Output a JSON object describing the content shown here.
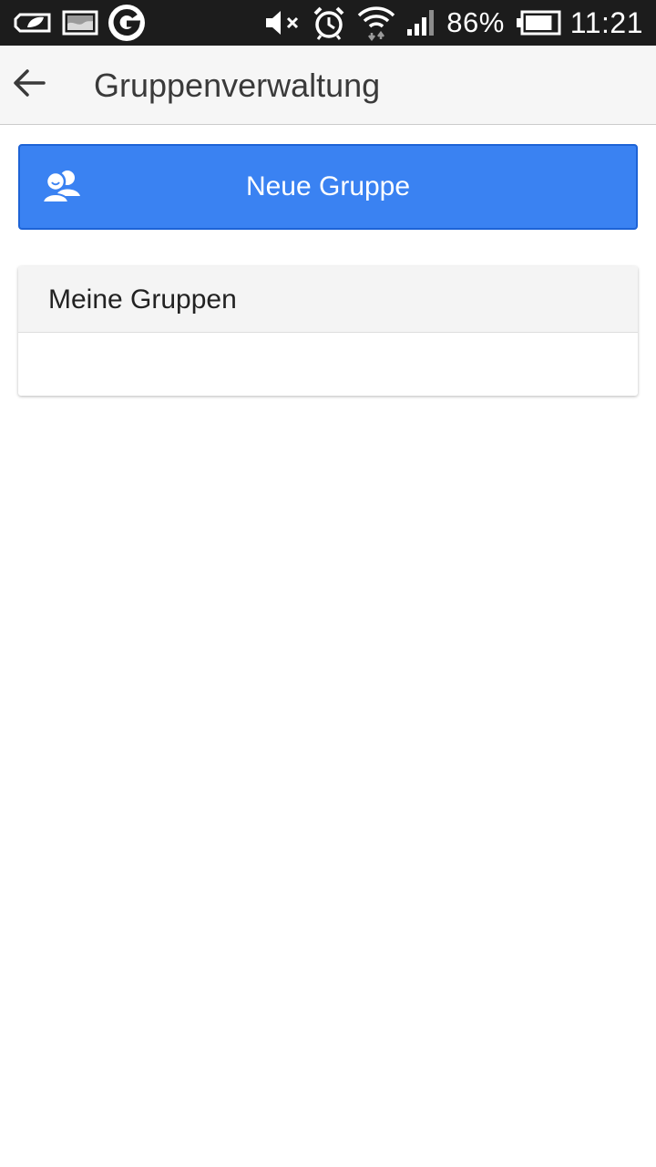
{
  "status_bar": {
    "icons_left": [
      "battery-saver-icon",
      "image-notification-icon",
      "g-app-icon"
    ],
    "icons_right": [
      "mute-icon",
      "alarm-icon",
      "wifi-icon",
      "signal-icon"
    ],
    "battery_percent": "86%",
    "battery_level": 0.86,
    "time": "11:21"
  },
  "app_bar": {
    "back_icon": "arrow-left-icon",
    "title": "Gruppenverwaltung"
  },
  "new_group_button": {
    "icon": "groups-icon",
    "label": "Neue Gruppe"
  },
  "my_groups": {
    "header": "Meine Gruppen",
    "items": []
  },
  "colors": {
    "accent": "#3a82f2",
    "status_bar_bg": "#1c1c1c",
    "app_bar_bg": "#f6f6f6"
  }
}
